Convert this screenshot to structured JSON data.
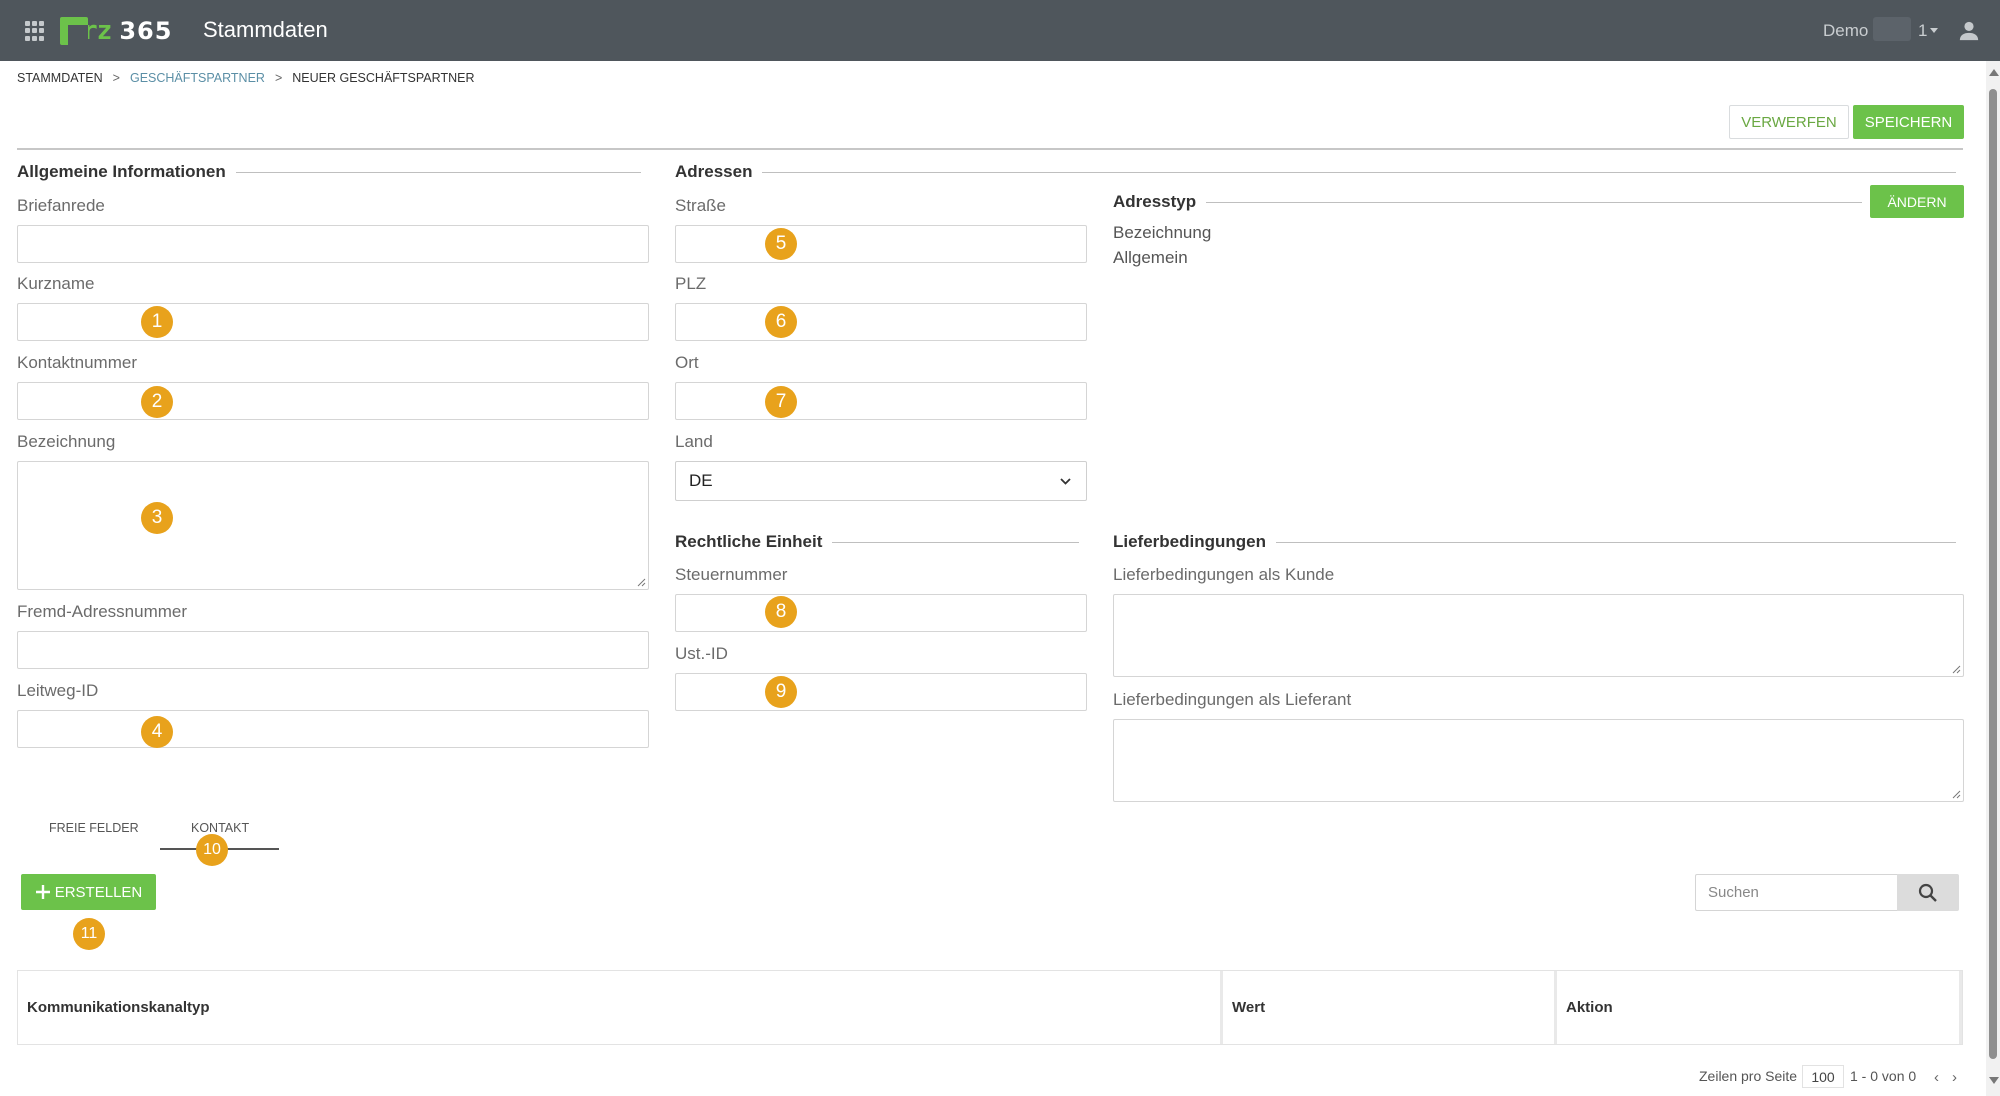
{
  "header": {
    "logo_text": "rz",
    "logo_num": "365",
    "app_title": "Stammdaten",
    "user_name": "Demo",
    "user_suffix": "1"
  },
  "breadcrumb": [
    "STAMMDATEN",
    "GESCHÄFTSPARTNER",
    "NEUER GESCHÄFTSPARTNER"
  ],
  "actions": {
    "discard": "VERWERFEN",
    "save": "SPEICHERN"
  },
  "general": {
    "title": "Allgemeine Informationen",
    "briefanrede": "Briefanrede",
    "kurzname": "Kurzname",
    "kontaktnummer": "Kontaktnummer",
    "bezeichnung": "Bezeichnung",
    "fremd_adressnummer": "Fremd-Adressnummer",
    "leitweg_id": "Leitweg-ID"
  },
  "addresses": {
    "title": "Adressen",
    "strasse": "Straße",
    "plz": "PLZ",
    "ort": "Ort",
    "land": "Land",
    "land_value": "DE"
  },
  "adresstyp": {
    "title": "Adresstyp",
    "change_button": "ÄNDERN",
    "label": "Bezeichnung",
    "value": "Allgemein"
  },
  "legal": {
    "title": "Rechtliche Einheit",
    "steuernummer": "Steuernummer",
    "ust_id": "Ust.-ID"
  },
  "delivery": {
    "title": "Lieferbedingungen",
    "as_customer": "Lieferbedingungen als Kunde",
    "as_supplier": "Lieferbedingungen als Lieferant"
  },
  "tabs": {
    "free_fields": "FREIE FELDER",
    "contact": "KONTAKT"
  },
  "create_button": "ERSTELLEN",
  "search": {
    "placeholder": "Suchen"
  },
  "table": {
    "columns": [
      "Kommunikationskanaltyp",
      "Wert",
      "Aktion"
    ]
  },
  "pagination": {
    "rows_per_page_label": "Zeilen pro Seite",
    "rows_per_page": "100",
    "range": "1 - 0 von 0"
  },
  "badges": [
    "1",
    "2",
    "3",
    "4",
    "5",
    "6",
    "7",
    "8",
    "9",
    "10",
    "11"
  ],
  "colors": {
    "accent_green": "#6cc24a",
    "header_bg": "#4f565c",
    "badge": "#e8a21c"
  }
}
